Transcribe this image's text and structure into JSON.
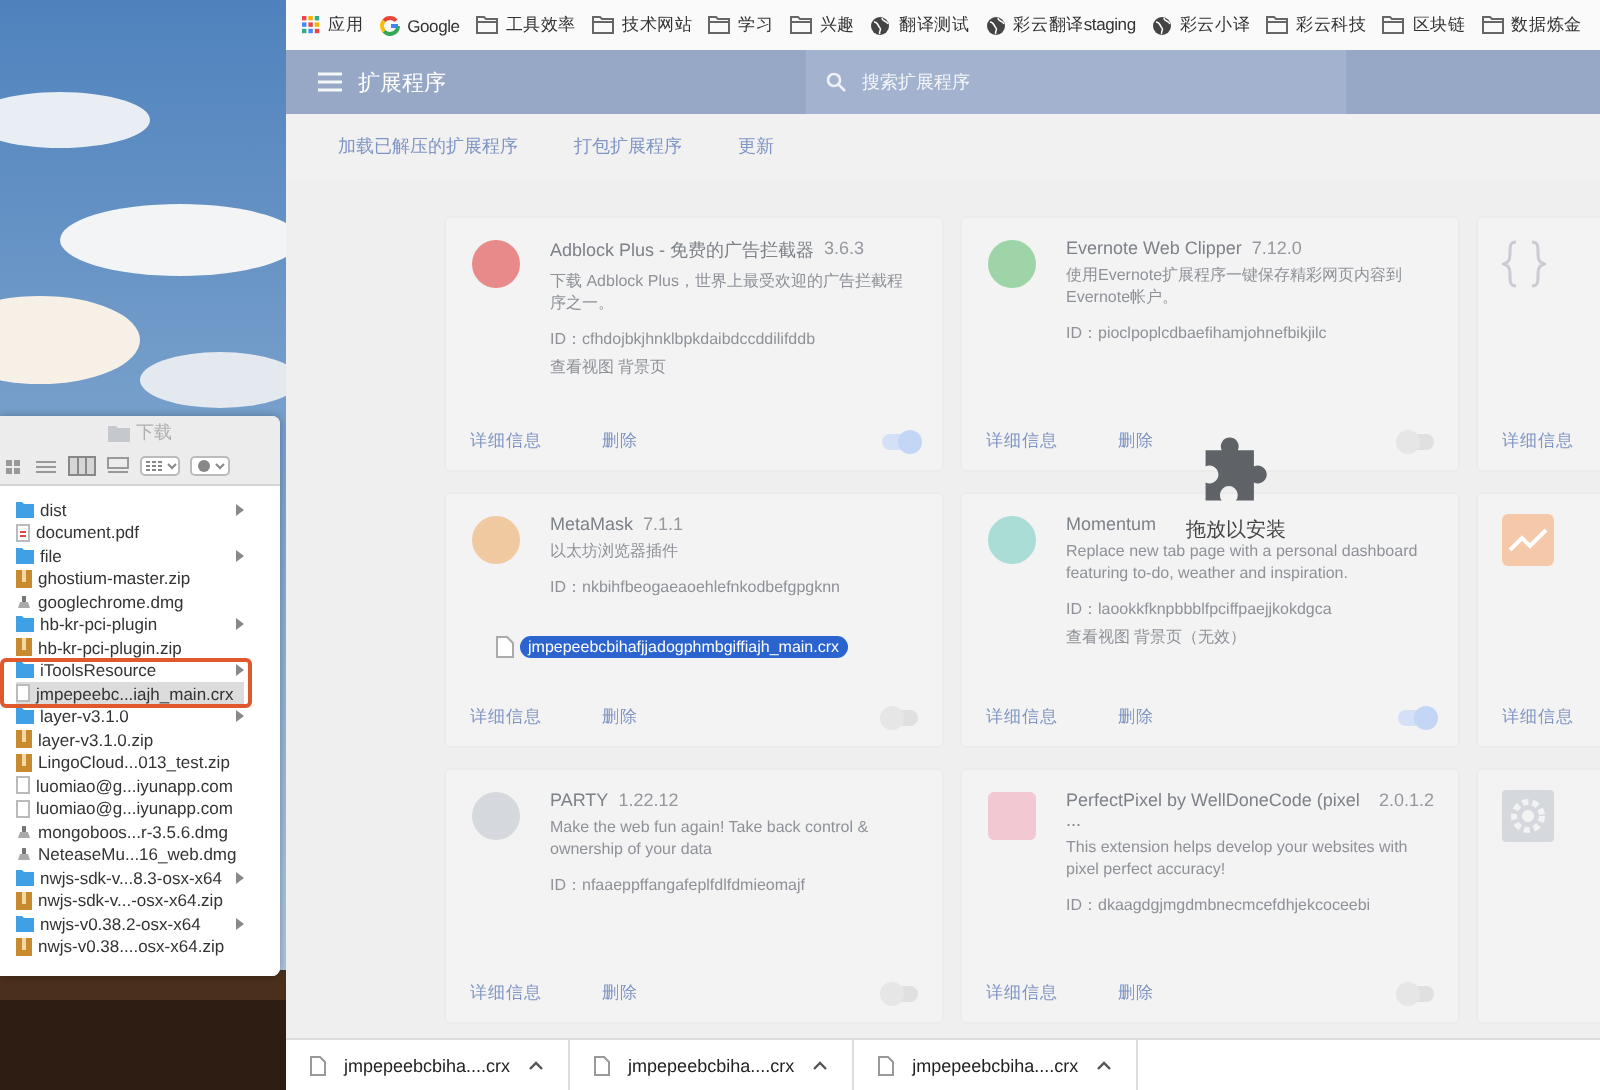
{
  "finder": {
    "title": "下载",
    "items": [
      {
        "kind": "folder",
        "name": "dist",
        "selected": false
      },
      {
        "kind": "pdf",
        "name": "document.pdf",
        "selected": false
      },
      {
        "kind": "folder",
        "name": "file",
        "selected": false
      },
      {
        "kind": "zip",
        "name": "ghostium-master.zip",
        "selected": false
      },
      {
        "kind": "dmg",
        "name": "googlechrome.dmg",
        "selected": false
      },
      {
        "kind": "folder",
        "name": "hb-kr-pci-plugin",
        "selected": false
      },
      {
        "kind": "zip",
        "name": "hb-kr-pci-plugin.zip",
        "selected": false
      },
      {
        "kind": "folder",
        "name": "iToolsResource",
        "selected": false
      },
      {
        "kind": "file",
        "name": "jmpepeebc...iajh_main.crx",
        "selected": true
      },
      {
        "kind": "folder",
        "name": "layer-v3.1.0",
        "selected": false
      },
      {
        "kind": "zip",
        "name": "layer-v3.1.0.zip",
        "selected": false
      },
      {
        "kind": "zip",
        "name": "LingoCloud...013_test.zip",
        "selected": false
      },
      {
        "kind": "file",
        "name": "luomiao@g...iyunapp.com",
        "selected": false
      },
      {
        "kind": "file",
        "name": "luomiao@g...iyunapp.com",
        "selected": false
      },
      {
        "kind": "dmg",
        "name": "mongoboos...r-3.5.6.dmg",
        "selected": false
      },
      {
        "kind": "dmg",
        "name": "NeteaseMu...16_web.dmg",
        "selected": false
      },
      {
        "kind": "folder",
        "name": "nwjs-sdk-v...8.3-osx-x64",
        "selected": false
      },
      {
        "kind": "zip",
        "name": "nwjs-sdk-v...-osx-x64.zip",
        "selected": false
      },
      {
        "kind": "folder",
        "name": "nwjs-v0.38.2-osx-x64",
        "selected": false
      },
      {
        "kind": "zip",
        "name": "nwjs-v0.38....osx-x64.zip",
        "selected": false
      }
    ]
  },
  "bookmarks": [
    {
      "kind": "apps",
      "label": "应用"
    },
    {
      "kind": "google",
      "label": "Google"
    },
    {
      "kind": "folder",
      "label": "工具效率"
    },
    {
      "kind": "folder",
      "label": "技术网站"
    },
    {
      "kind": "folder",
      "label": "学习"
    },
    {
      "kind": "folder",
      "label": "兴趣"
    },
    {
      "kind": "globe",
      "label": "翻译测试"
    },
    {
      "kind": "globe",
      "label": "彩云翻译staging"
    },
    {
      "kind": "globe",
      "label": "彩云小译"
    },
    {
      "kind": "folder",
      "label": "彩云科技"
    },
    {
      "kind": "folder",
      "label": "区块链"
    },
    {
      "kind": "folder",
      "label": "数据炼金"
    }
  ],
  "header": {
    "title": "扩展程序",
    "search_placeholder": "搜索扩展程序"
  },
  "toolbar": [
    "加载已解压的扩展程序",
    "打包扩展程序",
    "更新"
  ],
  "extensions": [
    {
      "kind": "circle",
      "color": "#e88a8a",
      "name": "Adblock Plus - 免费的广告拦截器",
      "version": "3.6.3",
      "description": "下载 Adblock Plus，世界上最受欢迎的广告拦截程序之一。",
      "id_line": "ID：cfhdojbkjhnklbpkdaibdccddilifddb",
      "views": "查看视图 背景页",
      "details": "详细信息",
      "remove": "删除",
      "enabled": true
    },
    {
      "kind": "circle",
      "color": "#9fd4a8",
      "name": "Evernote Web Clipper",
      "version": "7.12.0",
      "description": "使用Evernote扩展程序一键保存精彩网页内容到Evernote帐户。",
      "id_line": "ID：pioclpoplcdbaefihamjohnefbikjilc",
      "details": "详细信息",
      "remove": "删除",
      "enabled": false
    },
    {
      "kind": "braces",
      "color": "#c9ccd2",
      "details": "详细信息"
    },
    {
      "kind": "circle",
      "color": "#f0c9a0",
      "name": "MetaMask",
      "version": "7.1.1",
      "description": "以太坊浏览器插件",
      "id_line": "ID：nkbihfbeogaeaoehlefnkodbefgpgknn",
      "details": "详细信息",
      "remove": "删除",
      "enabled": false
    },
    {
      "kind": "circle",
      "color": "#a9ddd6",
      "name": "Momentum",
      "description": "Replace new tab page with a personal dashboard featuring to-do, weather and inspiration.",
      "id_line": "ID：laookkfknpbbblfpciffpaejjkokdgca",
      "views": "查看视图 背景页（无效）",
      "details": "详细信息",
      "remove": "删除",
      "enabled": true
    },
    {
      "kind": "chart",
      "color": "#f4c8a8",
      "details": "详细信息"
    },
    {
      "kind": "circle",
      "color": "#d5d8dd",
      "name": "PARTY",
      "version": "1.22.12",
      "description": "Make the web fun again! Take back control & ownership of your data",
      "id_line": "ID：nfaaeppffangafeplfdlfdmieomajf",
      "details": "详细信息",
      "remove": "删除",
      "enabled": false
    },
    {
      "kind": "square",
      "color": "#f2c8d2",
      "name": "PerfectPixel by WellDoneCode (pixel ...",
      "version": "2.0.1.2",
      "description": "This extension helps develop your websites with pixel perfect accuracy!",
      "id_line": "ID：dkaagdgjmgdmbnecmcefdhjekcoceebi",
      "details": "详细信息",
      "remove": "删除",
      "enabled": false
    },
    {
      "kind": "gear",
      "color": "#d5d8dd"
    }
  ],
  "drop_hint": "拖放以安装",
  "drag_file": "jmpepeebcbihafjjadogphmbgiffiajh_main.crx",
  "downloads": [
    "jmpepeebcbiha....crx",
    "jmpepeebcbiha....crx",
    "jmpepeebcbiha....crx"
  ]
}
